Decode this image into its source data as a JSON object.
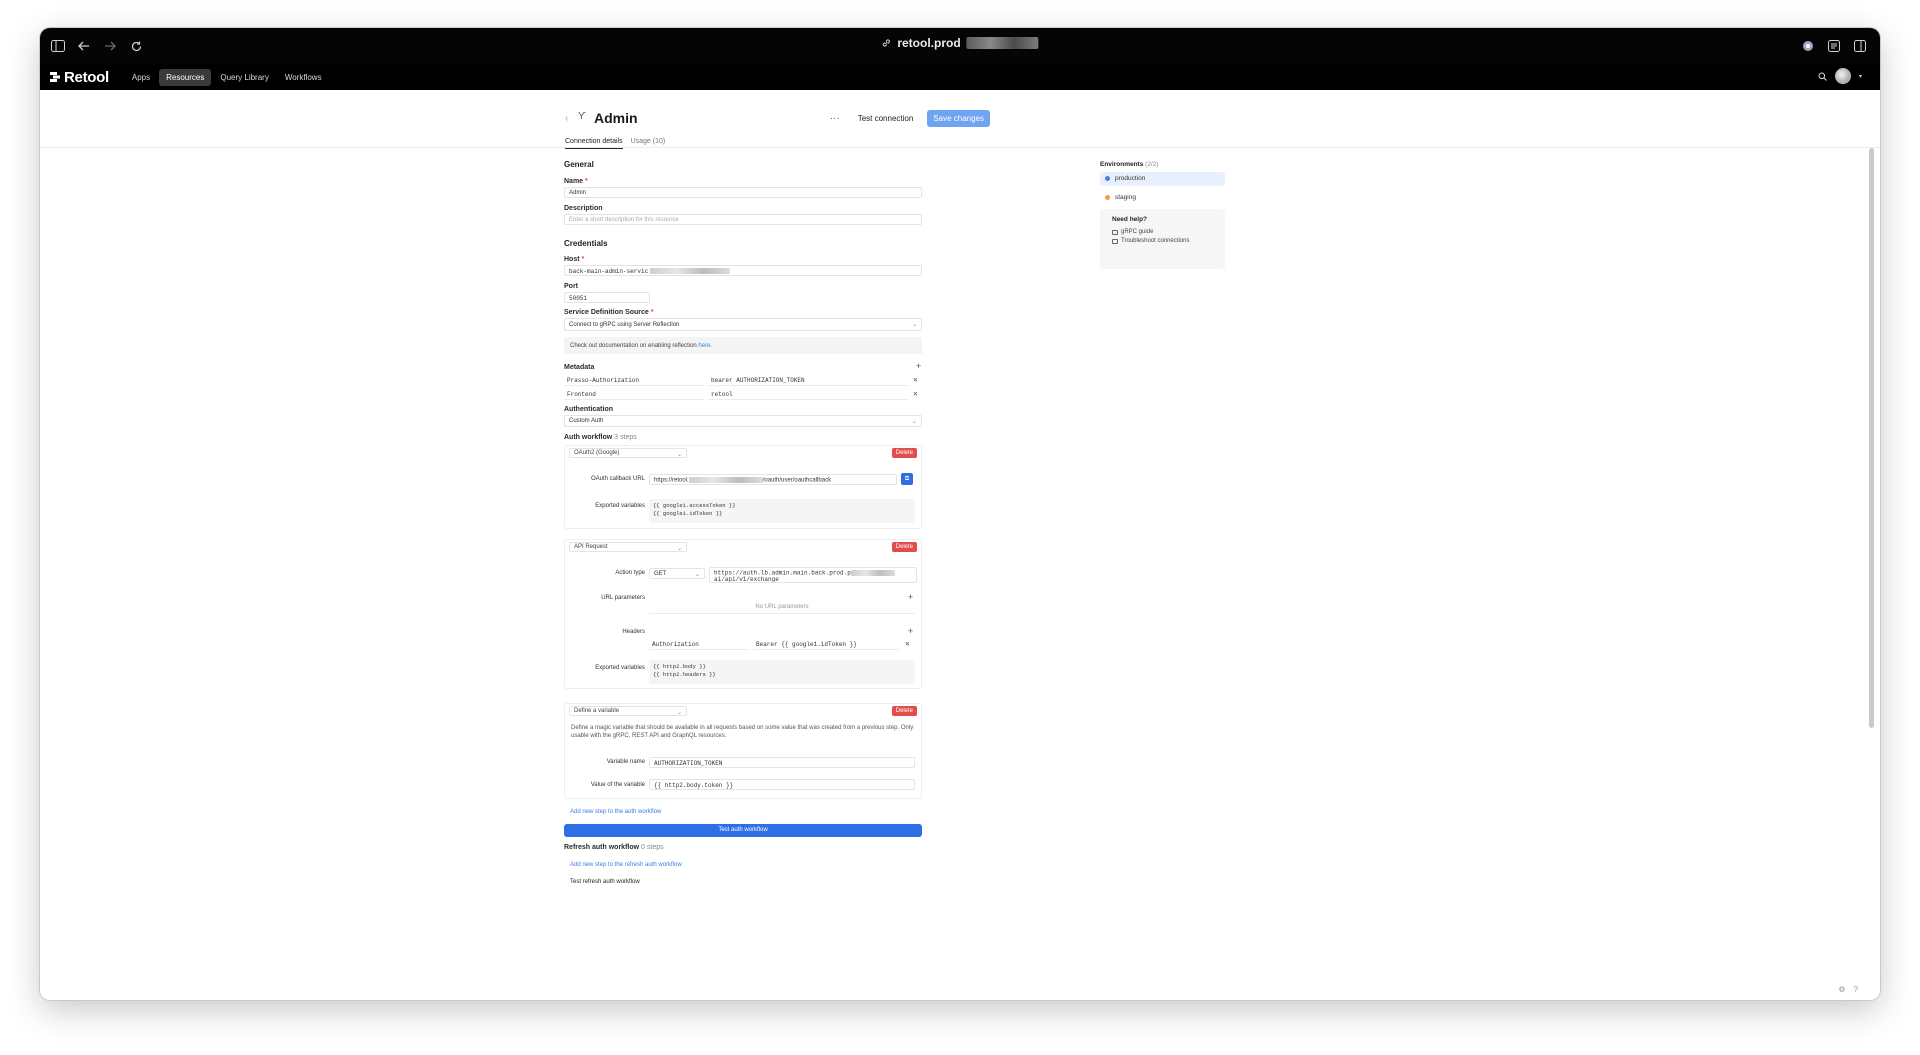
{
  "browser": {
    "url": "retool.prod"
  },
  "app_nav": {
    "logo": "Retool",
    "items": [
      {
        "label": "Apps",
        "active": false
      },
      {
        "label": "Resources",
        "active": true
      },
      {
        "label": "Query Library",
        "active": false
      },
      {
        "label": "Workflows",
        "active": false
      }
    ]
  },
  "header": {
    "title": "Admin",
    "more_label": "···",
    "test_connection": "Test connection",
    "save_changes": "Save changes"
  },
  "tabs": [
    {
      "label": "Connection details",
      "active": true
    },
    {
      "label": "Usage (10)",
      "active": false
    }
  ],
  "general": {
    "title": "General",
    "name_label": "Name",
    "name_value": "Admin",
    "description_label": "Description",
    "description_placeholder": "Enter a short description for this resource"
  },
  "credentials": {
    "title": "Credentials",
    "host_label": "Host",
    "host_value": "back-main-admin-servic",
    "port_label": "Port",
    "port_value": "50051",
    "sds_label": "Service Definition Source",
    "sds_value": "Connect to gRPC using Server Reflection",
    "note_text": "Check out documentation on enabling reflection ",
    "note_link": "here."
  },
  "metadata": {
    "title": "Metadata",
    "rows": [
      {
        "key": "Prasso-Authorization",
        "value": "bearer AUTHORIZATION_TOKEN"
      },
      {
        "key": "Frontend",
        "value": "retool"
      }
    ]
  },
  "authentication": {
    "label": "Authentication",
    "value": "Custom Auth"
  },
  "auth_workflow": {
    "title": "Auth workflow",
    "steps_count": "3 steps",
    "delete_label": "Delete",
    "step1": {
      "type": "OAuth2 (Google)",
      "callback_label": "OAuth callback URL",
      "callback_prefix": "https://retool.",
      "callback_suffix": "/oauth/user/oauthcallback",
      "exported_label": "Exported variables",
      "exported_lines": [
        "{{ google1.accessToken }}",
        "{{ google1.idToken }}"
      ]
    },
    "step2": {
      "type": "API Request",
      "action_label": "Action type",
      "method": "GET",
      "url_line1": "https://auth.lb.admin.main.back.prod.p",
      "url_line2": "ai/api/v1/exchange",
      "url_params_label": "URL parameters",
      "no_url_params": "No URL parameters",
      "headers_label": "Headers",
      "header_key": "Authorization",
      "header_value": "Bearer {{ google1.idToken }}",
      "exported_label": "Exported variables",
      "exported_lines": [
        "{{ http2.body }}",
        "{{ http2.headers }}"
      ]
    },
    "step3": {
      "type": "Define a variable",
      "description": "Define a magic variable that should be available in all requests based on some value that was created from a previous step. Only usable with the gRPC, REST API and GraphQL resources.",
      "var_name_label": "Variable name",
      "var_name_value": "AUTHORIZATION_TOKEN",
      "var_value_label": "Value of the variable",
      "var_value_value": "{{ http2.body.token }}"
    },
    "add_step": "Add new step to the auth workflow",
    "test_button": "Test auth workflow"
  },
  "refresh_workflow": {
    "title": "Refresh auth workflow",
    "steps_count": "0 steps",
    "add_step": "Add new step to the refresh auth workflow",
    "test_button": "Test refresh auth workflow"
  },
  "environments": {
    "title": "Environments",
    "count": "(2/2)",
    "items": [
      {
        "label": "production",
        "color": "#4a7fe0",
        "active": true
      },
      {
        "label": "staging",
        "color": "#e8a33b",
        "active": false
      }
    ]
  },
  "help": {
    "title": "Need help?",
    "links": [
      "gRPC guide",
      "Troubleshoot connections"
    ]
  }
}
